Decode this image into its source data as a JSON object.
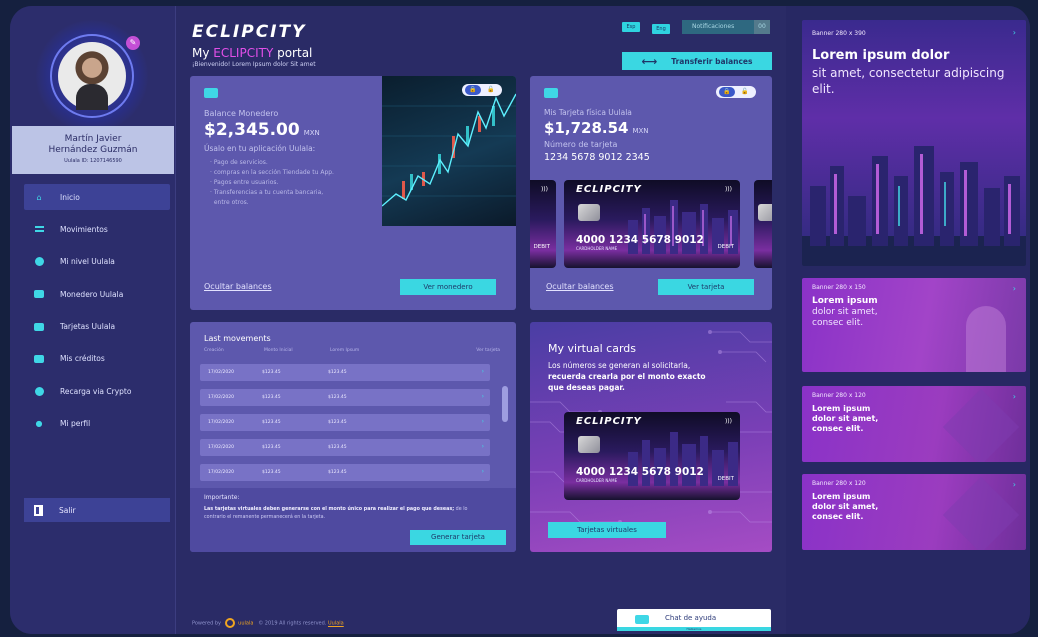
{
  "user": {
    "name_line1": "Martín Javier",
    "name_line2": "Hernández Guzmán",
    "id": "Uulala ID: 1207146590"
  },
  "nav": {
    "items": [
      {
        "label": "Inicio",
        "icon": "home-icon"
      },
      {
        "label": "Movimientos",
        "icon": "list-icon"
      },
      {
        "label": "Mi nivel Uulala",
        "icon": "level-icon"
      },
      {
        "label": "Monedero Uulala",
        "icon": "wallet-icon"
      },
      {
        "label": "Tarjetas Uulala",
        "icon": "card-icon"
      },
      {
        "label": "Mis créditos",
        "icon": "credit-icon"
      },
      {
        "label": "Recarga via Crypto",
        "icon": "bitcoin-icon"
      },
      {
        "label": "Mi perfil",
        "icon": "user-icon"
      }
    ],
    "logout": "Salir"
  },
  "header": {
    "logo": "ECLIPCITY",
    "title_prefix": "My ",
    "title_accent": "ECLIPCITY",
    "title_suffix": " portal",
    "subtitle": "¡Bienvenido! Lorem Ipsum dolor Sit amet",
    "lang_es": "Esp",
    "lang_en": "Eng",
    "notifications": "Notificaciones",
    "notifications_count": "00",
    "transfer_button": "Transferir balances"
  },
  "wallet": {
    "label": "Balance Monedero",
    "amount": "$2,345.00",
    "currency": "MXN",
    "use_title": "Úsalo en tu aplicación Uulala:",
    "uses": [
      "Pago de servicios.",
      "compras en la sección Tiendade tu App.",
      "Pagos entre usuarios.",
      "Transferencias a tu cuenta bancaria,",
      "entre otros."
    ],
    "hide_link": "Ocultar balances",
    "button": "Ver monedero"
  },
  "physical_card": {
    "label": "Mis Tarjeta física Uulala",
    "amount": "$1,728.54",
    "currency": "MXN",
    "number_label": "Número de tarjeta",
    "number": "1234 5678 9012 2345",
    "hide_link": "Ocultar balances",
    "button": "Ver tarjeta"
  },
  "card_art": {
    "brand": "ECLIPCITY",
    "number": "4000 1234 5678 9012",
    "holder": "CARDHOLDER NAME",
    "network": "DEBIT"
  },
  "movements": {
    "title": "Last movements",
    "columns": [
      "Creación",
      "Monto Inicial",
      "Lorem Ipsum",
      "Ver tarjeta"
    ],
    "rows": [
      [
        "17/02/2020",
        "$123.45",
        "$123.45"
      ],
      [
        "17/02/2020",
        "$123.45",
        "$123.45"
      ],
      [
        "17/02/2020",
        "$123.45",
        "$123.45"
      ],
      [
        "17/02/2020",
        "$123.45",
        "$123.45"
      ],
      [
        "17/02/2020",
        "$123.45",
        "$123.45"
      ]
    ],
    "important_label": "Importante:",
    "important_text_bold": "Las tarjetas virtuales deben generarse con el monto único para realizar el pago que deseas;",
    "important_text": " de lo contrario el remanente permanecerá en la tarjeta.",
    "button": "Generar tarjeta"
  },
  "virtual": {
    "title": "My virtual cards",
    "text1": "Los números se generan al solicitarla,",
    "text2": "recuerda crearla por el monto exacto",
    "text3": "que deseas pagar.",
    "button": "Tarjetas virtuales"
  },
  "banners": [
    {
      "tag": "Banner 280 x 390",
      "head": "Lorem ipsum dolor",
      "body": "sit amet, consectetur adipiscing elit."
    },
    {
      "tag": "Banner 280 x 150",
      "head": "Lorem ipsum",
      "body": "dolor sit amet, consec elit."
    },
    {
      "tag": "Banner 280 x 120",
      "head": "Lorem ipsum dolor sit amet, consec elit.",
      "body": ""
    },
    {
      "tag": "Banner 280 x 120",
      "head": "Lorem ipsum dolor sit amet, consec elit.",
      "body": ""
    }
  ],
  "footer": {
    "powered": "Powered by",
    "brand": "uulala",
    "rights": "© 2019 All rights reserved.",
    "link": "Uulala"
  },
  "chat": {
    "label": "Chat de ayuda",
    "sub": "Hablemos"
  }
}
